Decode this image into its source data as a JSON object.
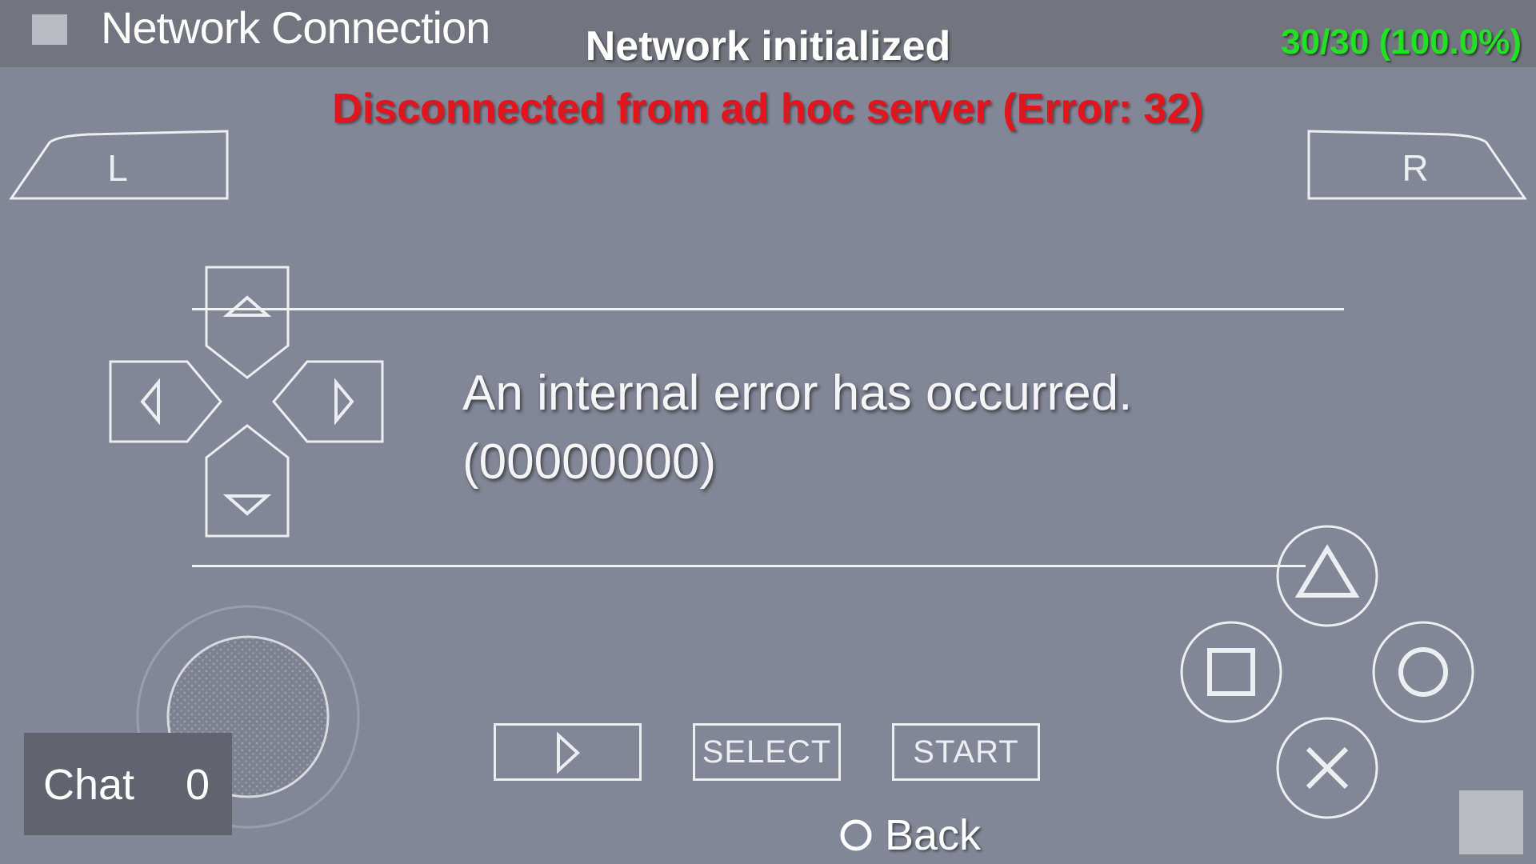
{
  "header": {
    "title": "Network Connection",
    "fps_text": "30/30 (100.0%)",
    "fps_color": "#22e022"
  },
  "notifications": {
    "info": "Network initialized",
    "error": "Disconnected from ad hoc server (Error: 32)"
  },
  "dialog": {
    "message_line1": "An internal error has occurred.",
    "message_line2": "(00000000)",
    "back_label": "Back"
  },
  "controls": {
    "l_label": "L",
    "r_label": "R",
    "select_label": "SELECT",
    "start_label": "START",
    "chat_label": "Chat",
    "chat_count": "0"
  },
  "icons": {
    "menu": "menu-square-icon",
    "dpad": [
      "dpad-up-icon",
      "dpad-left-icon",
      "dpad-right-icon",
      "dpad-down-icon"
    ],
    "face": [
      "triangle-icon",
      "square-icon",
      "circle-icon",
      "cross-icon"
    ],
    "fast_forward": "play-arrow-icon",
    "back": "circle-icon"
  },
  "colors": {
    "error_text": "#e3141b",
    "background": "#838696",
    "topbar": "#72757f"
  }
}
